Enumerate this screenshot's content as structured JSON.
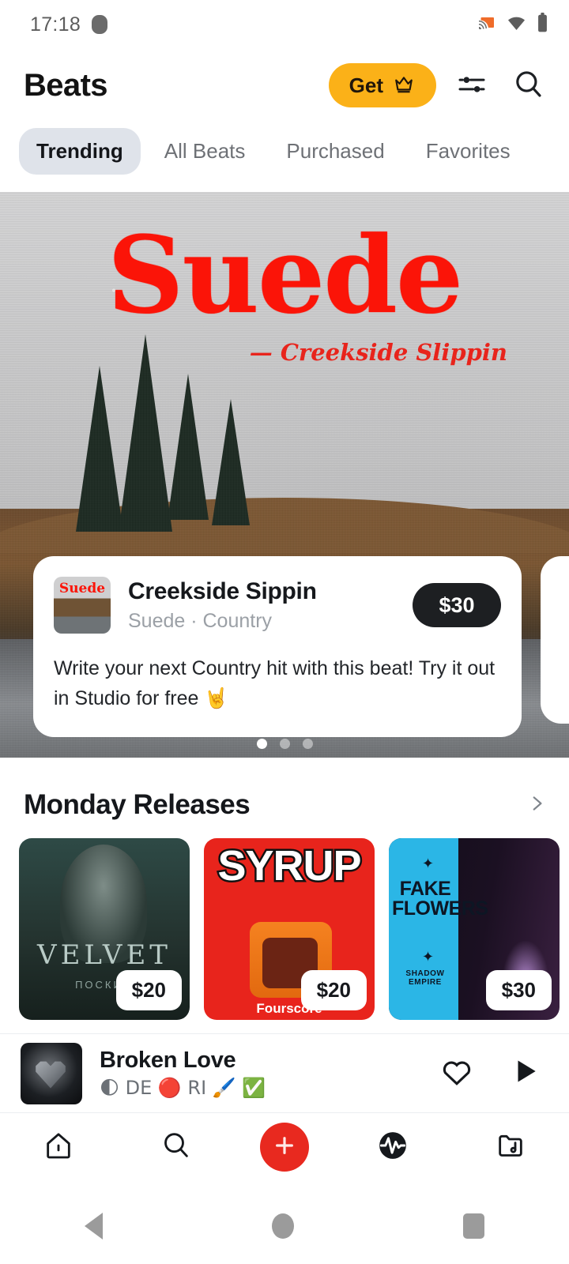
{
  "status_bar": {
    "time": "17:18",
    "icons": [
      "cast-icon",
      "wifi-icon",
      "battery-icon"
    ]
  },
  "header": {
    "app_title": "Beats",
    "get_button_label": "Get",
    "get_button_color": "#FBB118",
    "icons": [
      "crown-icon",
      "filter-icon",
      "search-icon"
    ]
  },
  "tabs": [
    {
      "label": "Trending",
      "active": true
    },
    {
      "label": "All Beats",
      "active": false
    },
    {
      "label": "Purchased",
      "active": false
    },
    {
      "label": "Favorites",
      "active": false
    }
  ],
  "hero": {
    "wordmark": "Suede",
    "subtitle": "— Creekside Slippin",
    "wordmark_color": "#fb1408",
    "card": {
      "thumb_text": "Suede",
      "title": "Creekside Sippin",
      "artist_genre": "Suede · Country",
      "price": "$30",
      "description": "Write your next Country hit with this beat! Try it out in Studio for free 🤘"
    },
    "dots": {
      "count": 3,
      "active_index": 0
    }
  },
  "section": {
    "title": "Monday Releases",
    "chevron": "chevron-right-icon",
    "albums": [
      {
        "title": "VELVET",
        "subtitle": "ПОСКИО",
        "price": "$20",
        "star": ""
      },
      {
        "title": "SYRUP",
        "subtitle": "Fourscore",
        "price": "$20",
        "star": ""
      },
      {
        "title": "FAKE FLOWERS",
        "subtitle": "SHADOW EMPIRE",
        "price": "$30",
        "star": "✦"
      }
    ]
  },
  "now_playing": {
    "title": "Broken Love",
    "subtitle": "🌓 DE 🔴 RI 🖌️ ✅",
    "actions": [
      "heart-icon",
      "play-icon"
    ]
  },
  "bottom_nav": [
    {
      "name": "home-icon"
    },
    {
      "name": "search-icon"
    },
    {
      "name": "add-icon"
    },
    {
      "name": "waveform-icon"
    },
    {
      "name": "library-icon"
    }
  ],
  "system_nav": [
    "back-button",
    "home-button",
    "recents-button"
  ]
}
